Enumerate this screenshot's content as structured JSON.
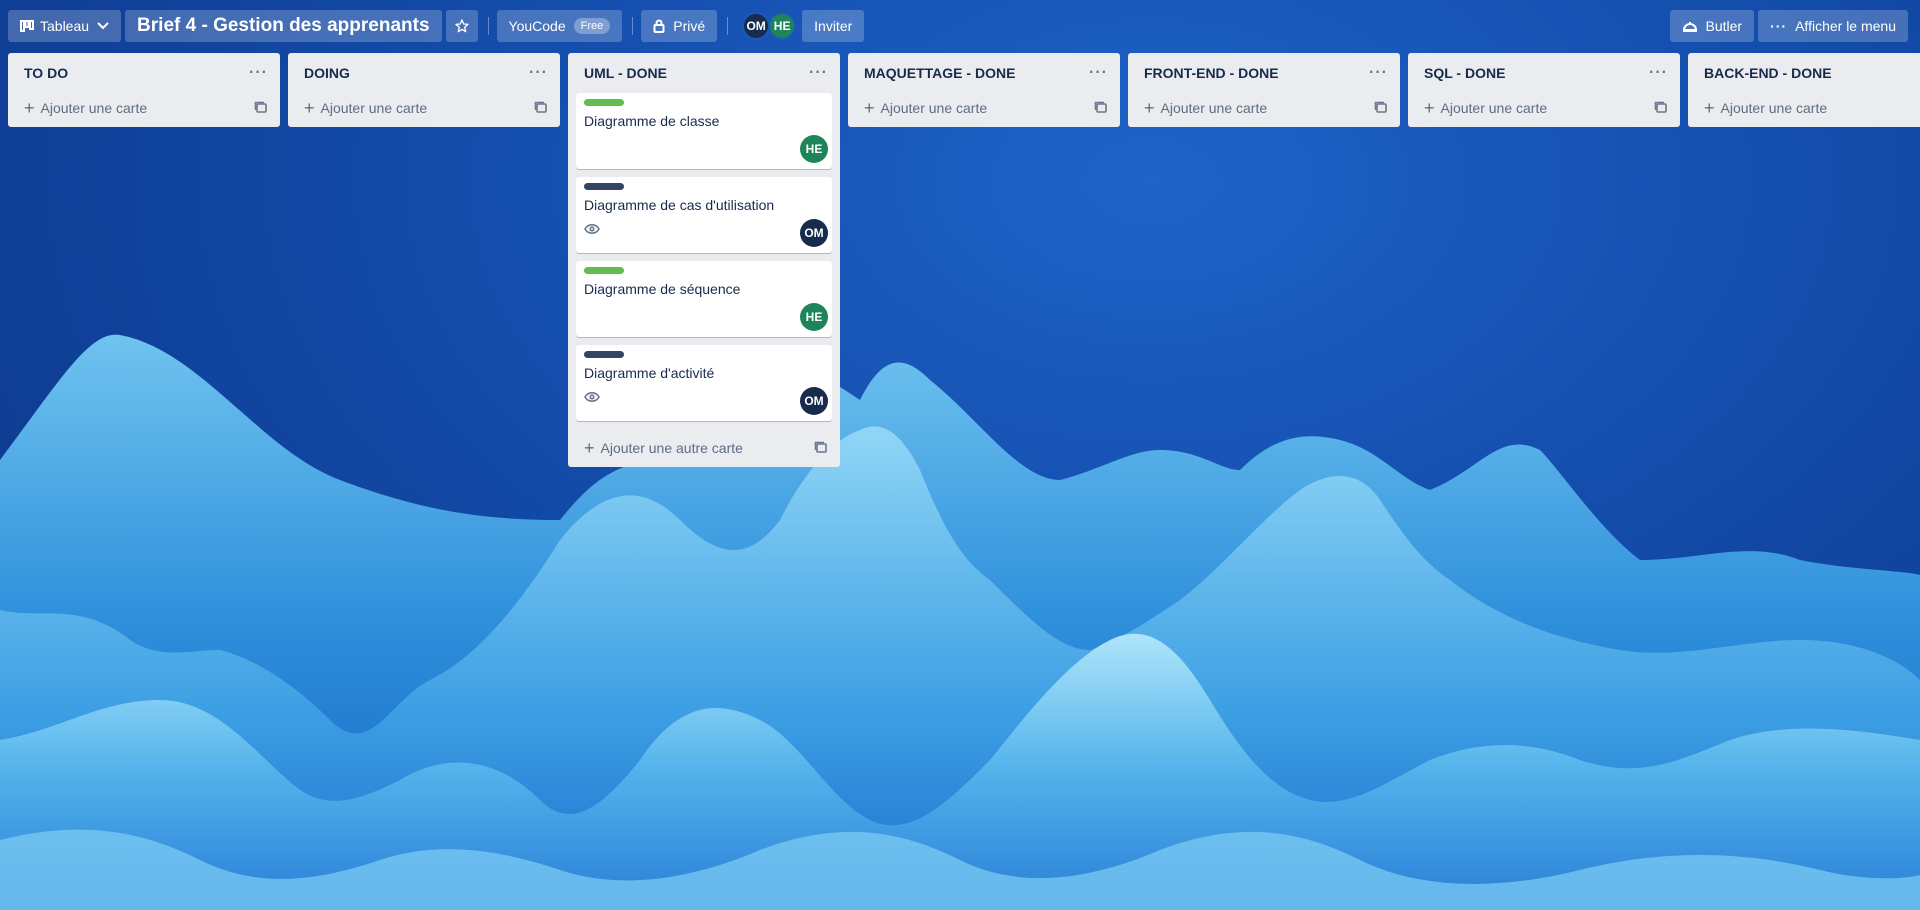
{
  "header": {
    "view_switcher": "Tableau",
    "board_title": "Brief 4 - Gestion des apprenants",
    "workspace": "YouCode",
    "workspace_badge": "Free",
    "visibility": "Privé",
    "invite": "Inviter",
    "butler": "Butler",
    "menu": "Afficher le menu",
    "members": [
      "OM",
      "HE"
    ]
  },
  "lists": [
    {
      "title": "TO DO",
      "add_label": "Ajouter une carte",
      "cards": []
    },
    {
      "title": "DOING",
      "add_label": "Ajouter une carte",
      "cards": []
    },
    {
      "title": "UML - DONE",
      "add_label": "Ajouter une autre carte",
      "cards": [
        {
          "label_color": "#61bd4f",
          "title": "Diagramme de classe",
          "watch": false,
          "member": "HE"
        },
        {
          "label_color": "#344563",
          "title": "Diagramme de cas d'utilisation",
          "watch": true,
          "member": "OM"
        },
        {
          "label_color": "#61bd4f",
          "title": "Diagramme de séquence",
          "watch": false,
          "member": "HE"
        },
        {
          "label_color": "#344563",
          "title": "Diagramme d'activité",
          "watch": true,
          "member": "OM"
        }
      ]
    },
    {
      "title": "MAQUETTAGE - DONE",
      "add_label": "Ajouter une carte",
      "cards": []
    },
    {
      "title": "FRONT-END - DONE",
      "add_label": "Ajouter une carte",
      "cards": []
    },
    {
      "title": "SQL - DONE",
      "add_label": "Ajouter une carte",
      "cards": []
    },
    {
      "title": "BACK-END - DONE",
      "add_label": "Ajouter une carte",
      "cards": []
    }
  ],
  "colors": {
    "label_green": "#61bd4f",
    "label_dark": "#344563",
    "member_om": "#172b4d",
    "member_he": "#1f845a"
  }
}
